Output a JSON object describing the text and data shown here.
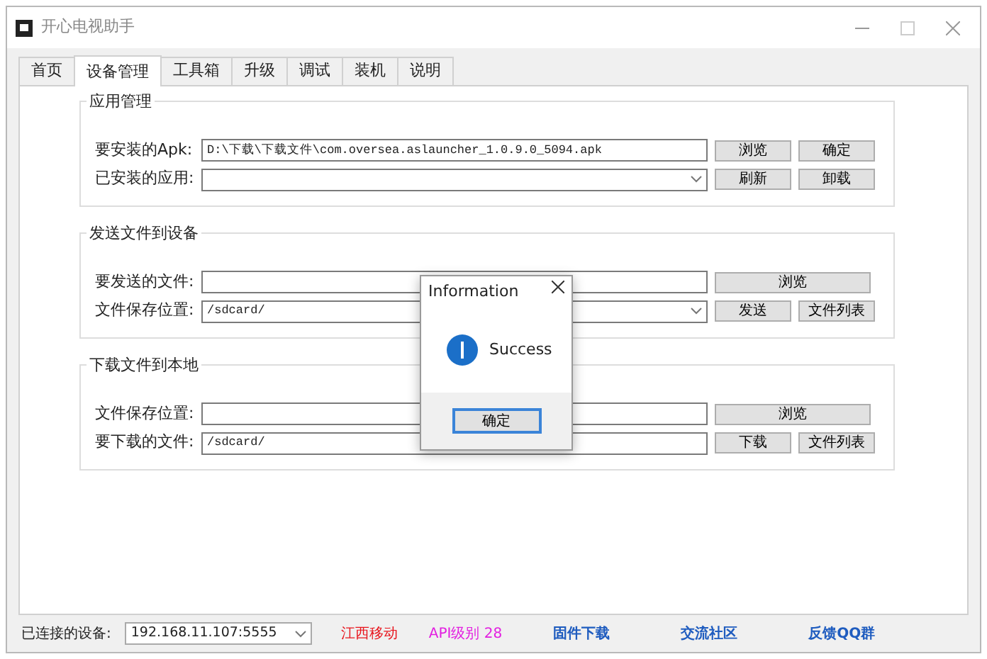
{
  "window": {
    "title": "开心电视助手"
  },
  "tabs": [
    {
      "label": "首页",
      "selected": false
    },
    {
      "label": "设备管理",
      "selected": true
    },
    {
      "label": "工具箱",
      "selected": false
    },
    {
      "label": "升级",
      "selected": false
    },
    {
      "label": "调试",
      "selected": false
    },
    {
      "label": "装机",
      "selected": false
    },
    {
      "label": "说明",
      "selected": false
    }
  ],
  "groups": [
    {
      "title": "应用管理",
      "rows": [
        {
          "label": "要安装的Apk:",
          "field": {
            "kind": "text",
            "value": "D:\\下载\\下载文件\\com.oversea.aslauncher_1.0.9.0_5094.apk"
          },
          "buttons": [
            {
              "label": "浏览"
            },
            {
              "label": "确定"
            }
          ]
        },
        {
          "label": "已安装的应用:",
          "field": {
            "kind": "combo"
          },
          "buttons": [
            {
              "label": "刷新"
            },
            {
              "label": "卸载"
            }
          ]
        }
      ]
    },
    {
      "title": "发送文件到设备",
      "rows": [
        {
          "label": "要发送的文件:",
          "field": {
            "kind": "text"
          },
          "buttons": [
            {
              "label": "浏览"
            }
          ]
        },
        {
          "label": "文件保存位置:",
          "field": {
            "kind": "combo",
            "value": "/sdcard/"
          },
          "buttons": [
            {
              "label": "发送"
            },
            {
              "label": "文件列表"
            }
          ]
        }
      ]
    },
    {
      "title": "下载文件到本地",
      "rows": [
        {
          "label": "文件保存位置:",
          "field": {
            "kind": "text"
          },
          "buttons": [
            {
              "label": "浏览"
            }
          ]
        },
        {
          "label": "要下载的文件:",
          "field": {
            "kind": "text",
            "value": "/sdcard/"
          },
          "buttons": [
            {
              "label": "下载"
            },
            {
              "label": "文件列表"
            }
          ]
        }
      ]
    }
  ],
  "dialog": {
    "title": "Information",
    "message": "Success",
    "button": "确定"
  },
  "status_bar": {
    "device_label": "已连接的设备:",
    "device_value": "192.168.11.107:5555",
    "items": [
      {
        "text": "江西移动",
        "kind": "text",
        "color": "#e8141c"
      },
      {
        "text": "API级别 28",
        "kind": "text",
        "color": "#e21ee0"
      },
      {
        "text": "固件下载",
        "kind": "link",
        "color": "#1f5cbf"
      },
      {
        "text": "交流社区",
        "kind": "link",
        "color": "#1f5cbf"
      },
      {
        "text": "反馈QQ群",
        "kind": "link",
        "color": "#1f5cbf"
      }
    ]
  }
}
